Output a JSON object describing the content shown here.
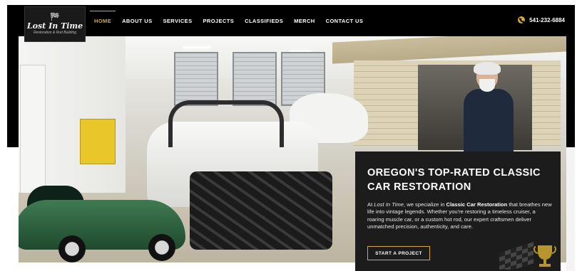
{
  "brand": {
    "logo_flags": "🏁",
    "name": "Lost In Time",
    "tagline": "Restoration & Rod Building"
  },
  "nav": {
    "items": [
      {
        "label": "HOME",
        "active": true
      },
      {
        "label": "ABOUT US",
        "active": false
      },
      {
        "label": "SERVICES",
        "active": false
      },
      {
        "label": "PROJECTS",
        "active": false
      },
      {
        "label": "CLASSIFIEDS",
        "active": false
      },
      {
        "label": "MERCH",
        "active": false
      },
      {
        "label": "CONTACT US",
        "active": false
      }
    ]
  },
  "phone": {
    "icon": "phone-icon",
    "number": "541-232-6884"
  },
  "hero": {
    "title": "OREGON'S TOP-RATED CLASSIC CAR RESTORATION",
    "body_prefix": "At ",
    "body_brand": "Lost In Time",
    "body_mid": ", we specialize in ",
    "body_strong": "Classic Car Restoration",
    "body_rest": " that breathes new life into vintage legends. Whether you're restoring a timeless cruiser, a roaring muscle car, or a custom hot rod, our expert craftsmen deliver unmatched precision, authenticity, and care.",
    "cta_label": "START A PROJECT",
    "decor_icon": "checkered-flag-trophy-icon"
  },
  "colors": {
    "accent": "#d8aa3a",
    "header_bg": "#000000",
    "card_bg": "#1c1c1c"
  }
}
